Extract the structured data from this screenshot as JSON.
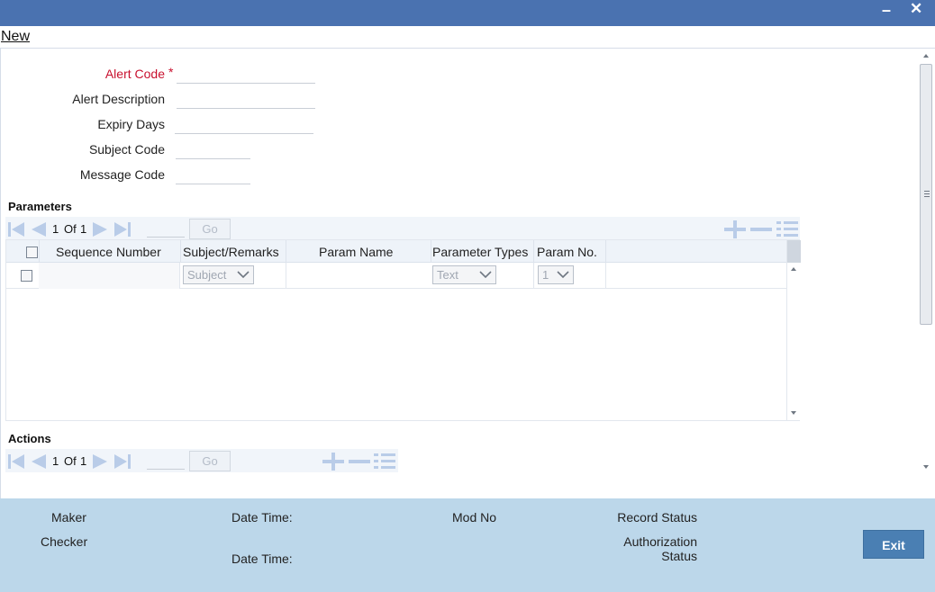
{
  "window": {
    "minimize": "minimize",
    "close": "close"
  },
  "menu": {
    "new_label": "New"
  },
  "form": {
    "alert_code_label": "Alert Code",
    "required_mark": "*",
    "alert_description_label": "Alert Description",
    "expiry_days_label": "Expiry Days",
    "subject_code_label": "Subject Code",
    "message_code_label": "Message Code",
    "alert_code_value": "",
    "alert_description_value": "",
    "expiry_days_value": "",
    "subject_code_value": "",
    "message_code_value": ""
  },
  "parameters": {
    "title": "Parameters",
    "pager": {
      "current": "1",
      "of": "Of",
      "total": "1",
      "go_label": "Go"
    },
    "columns": [
      "Sequence Number",
      "Subject/Remarks",
      "Param Name",
      "Parameter Types",
      "Param No."
    ],
    "row": {
      "subject": "Subject",
      "param_type": "Text",
      "param_no": "1"
    }
  },
  "actions": {
    "title": "Actions",
    "pager": {
      "current": "1",
      "of": "Of",
      "total": "1",
      "go_label": "Go"
    }
  },
  "footer": {
    "maker_label": "Maker",
    "checker_label": "Checker",
    "date_time_label": "Date Time:",
    "mod_no_label": "Mod No",
    "record_status_label": "Record Status",
    "authorization_label": "Authorization",
    "status_label": "Status",
    "exit_label": "Exit"
  },
  "colors": {
    "titlebar": "#4a72b0",
    "required": "#c8102e",
    "footer": "#bcd7ea",
    "exit_button": "#4a7fb3",
    "nav_icon": "#b9cce8"
  }
}
